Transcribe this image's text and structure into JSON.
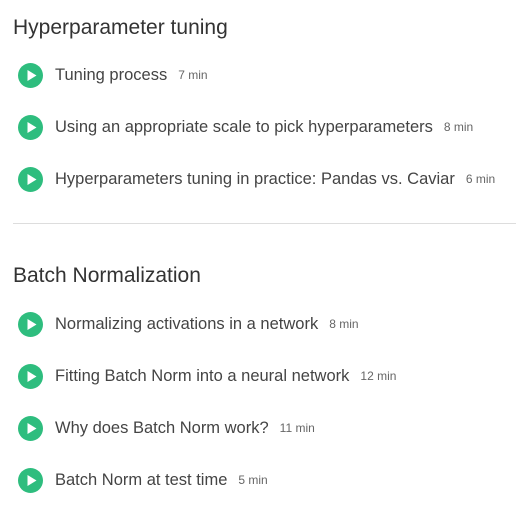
{
  "sections": [
    {
      "title": "Hyperparameter tuning",
      "lessons": [
        {
          "title": "Tuning process",
          "duration": "7 min"
        },
        {
          "title": "Using an appropriate scale to pick hyperparameters",
          "duration": "8 min"
        },
        {
          "title": "Hyperparameters tuning in practice: Pandas vs. Caviar",
          "duration": "6 min"
        }
      ]
    },
    {
      "title": "Batch Normalization",
      "lessons": [
        {
          "title": "Normalizing activations in a network",
          "duration": "8 min"
        },
        {
          "title": "Fitting Batch Norm into a neural network",
          "duration": "12 min"
        },
        {
          "title": "Why does Batch Norm work?",
          "duration": "11 min"
        },
        {
          "title": "Batch Norm at test time",
          "duration": "5 min"
        }
      ]
    }
  ],
  "colors": {
    "play_icon": "#2ebd7e",
    "divider": "#dddddd"
  },
  "icons": {
    "lesson": "play-circle-icon"
  }
}
